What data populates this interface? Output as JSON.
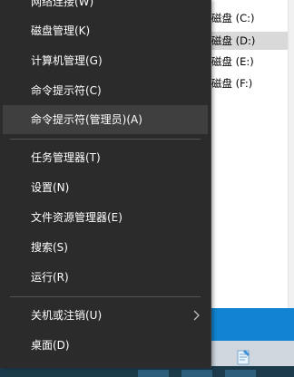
{
  "background": {
    "drives": [
      {
        "label": "磁盘 (C:)",
        "selected": false
      },
      {
        "label": "磁盘 (D:)",
        "selected": true
      },
      {
        "label": "磁盘 (E:)",
        "selected": false
      },
      {
        "label": "磁盘 (F:)",
        "selected": false
      }
    ],
    "taskbar_color": "#1283d1"
  },
  "menu": {
    "items": [
      {
        "label": "网络连接(W)"
      },
      {
        "label": "磁盘管理(K)"
      },
      {
        "label": "计算机管理(G)"
      },
      {
        "label": "命令提示符(C)"
      },
      {
        "label": "命令提示符(管理员)(A)",
        "highlighted": true
      },
      {
        "label": "任务管理器(T)"
      },
      {
        "label": "设置(N)"
      },
      {
        "label": "文件资源管理器(E)"
      },
      {
        "label": "搜索(S)"
      },
      {
        "label": "运行(R)"
      },
      {
        "label": "关机或注销(U)",
        "submenu": true,
        "icon": "chevron-right-icon"
      },
      {
        "label": "桌面(D)"
      }
    ],
    "colors": {
      "bg": "#2b2b2b",
      "text": "#ffffff",
      "highlight": "#3f3f3f",
      "separator": "#555555"
    }
  }
}
